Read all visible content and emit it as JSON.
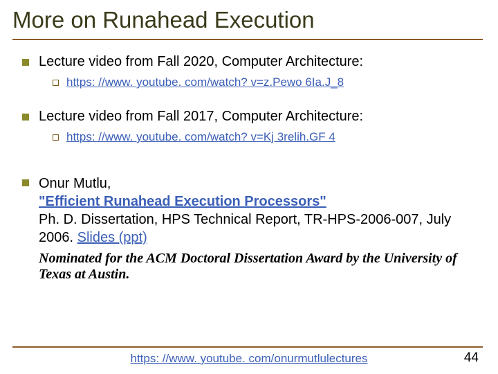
{
  "title": "More on Runahead Execution",
  "items": [
    {
      "text": "Lecture video from Fall 2020, Computer Architecture:",
      "sub": {
        "link": "https: //www. youtube. com/watch? v=z.Pewo 6Ia.J_8"
      }
    },
    {
      "text": "Lecture video from Fall 2017, Computer Architecture:",
      "sub": {
        "link": "https: //www. youtube. com/watch? v=Kj 3relih.GF 4"
      }
    },
    {
      "citation": {
        "author": "Onur Mutlu,",
        "paper_title": "\"Efficient Runahead Execution Processors\"",
        "rest": "Ph. D. Dissertation, HPS Technical Report, TR-HPS-2006-007, July 2006. ",
        "slides_link": "Slides (ppt)",
        "nominated": "Nominated for the ACM Doctoral Dissertation Award by the University of Texas at Austin."
      }
    }
  ],
  "footer_link": "https: //www. youtube. com/onurmutlulectures",
  "page_number": "44"
}
